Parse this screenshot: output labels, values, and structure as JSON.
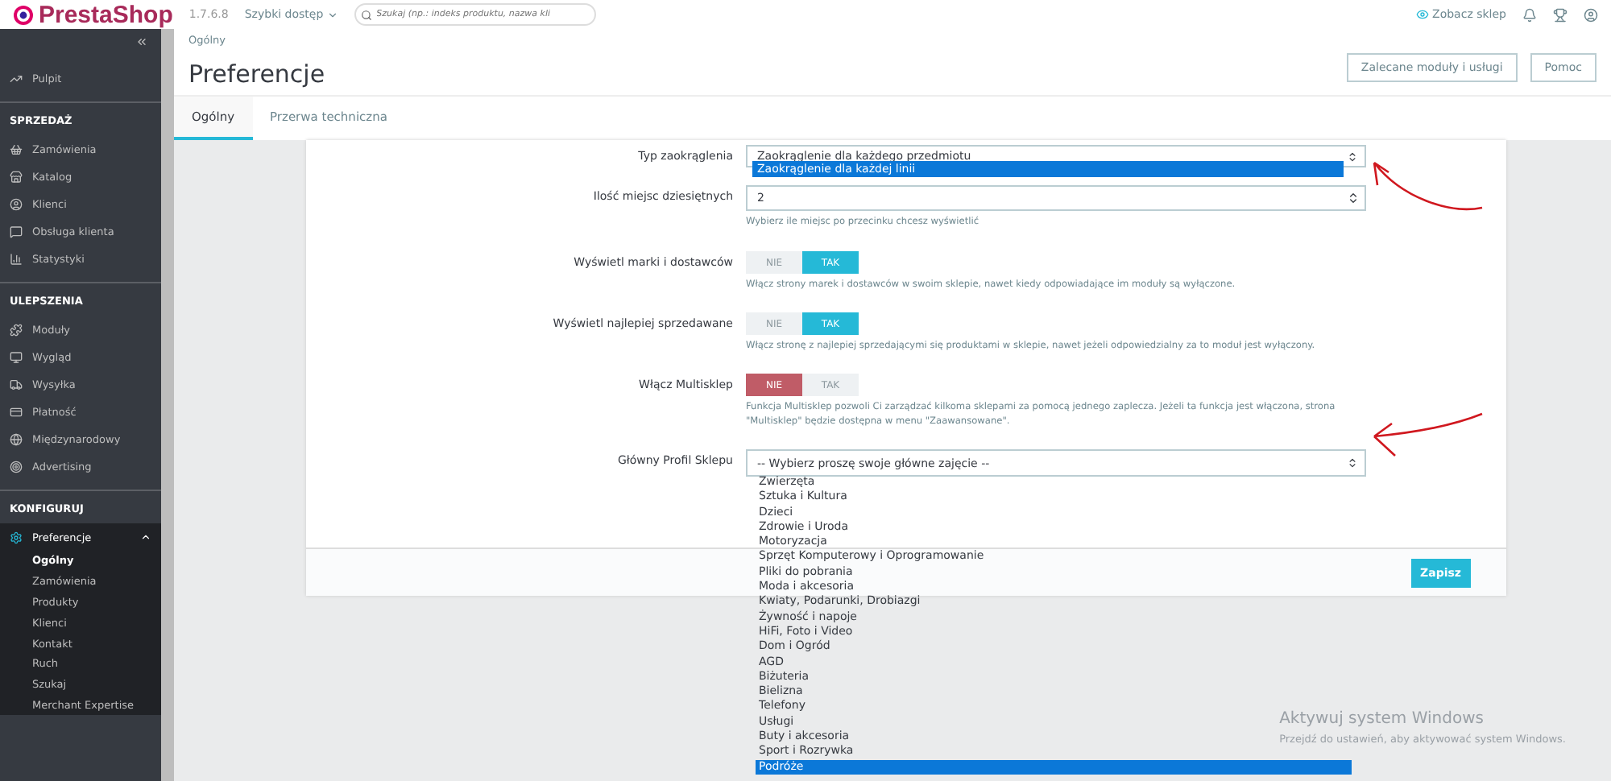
{
  "topbar": {
    "logo": "PrestaShop",
    "version": "1.7.6.8",
    "quick_access": "Szybki dostęp",
    "search": {
      "placeholder": "Szukaj (np.: indeks produktu, nazwa kli"
    },
    "view_shop": "Zobacz sklep"
  },
  "sidebar": {
    "dashboard": {
      "label": "Pulpit",
      "selected": false
    },
    "sections": [
      {
        "title": "SPRZEDAŻ",
        "items": [
          {
            "label": "Zamówienia",
            "selected": false
          },
          {
            "label": "Katalog",
            "selected": false
          },
          {
            "label": "Klienci",
            "selected": false
          },
          {
            "label": "Obsługa klienta",
            "selected": false
          },
          {
            "label": "Statystyki",
            "selected": false
          }
        ]
      },
      {
        "title": "ULEPSZENIA",
        "items": [
          {
            "label": "Moduły",
            "selected": false
          },
          {
            "label": "Wygląd",
            "selected": false
          },
          {
            "label": "Wysyłka",
            "selected": false
          },
          {
            "label": "Płatność",
            "selected": false
          },
          {
            "label": "Międzynarodowy",
            "selected": false
          },
          {
            "label": "Advertising",
            "selected": false
          }
        ]
      },
      {
        "title": "KONFIGURUJ",
        "items": [
          {
            "label": "Preferencje",
            "selected": true,
            "expanded": true,
            "children": [
              {
                "label": "Ogólny",
                "selected": true
              },
              {
                "label": "Zamówienia",
                "selected": false
              },
              {
                "label": "Produkty",
                "selected": false
              },
              {
                "label": "Klienci",
                "selected": false
              },
              {
                "label": "Kontakt",
                "selected": false
              },
              {
                "label": "Ruch",
                "selected": false
              },
              {
                "label": "Szukaj",
                "selected": false
              },
              {
                "label": "Merchant Expertise",
                "selected": false
              }
            ]
          }
        ]
      }
    ]
  },
  "header": {
    "breadcrumb": "Ogólny",
    "title": "Preferencje",
    "buttons": [
      "Zalecane moduły i usługi",
      "Pomoc"
    ],
    "tabs": [
      {
        "label": "Ogólny",
        "selected": true
      },
      {
        "label": "Przerwa techniczna",
        "selected": false
      }
    ]
  },
  "form": {
    "fields": [
      {
        "kind": "select",
        "label": "Typ zaokrąglenia",
        "value": "Zaokrąglenie dla każdego przedmiotu",
        "open_option": {
          "label": "Zaokrąglenie dla każdej linii",
          "selected": true
        }
      },
      {
        "kind": "number",
        "label": "Ilość miejsc dziesiętnych",
        "value": "2",
        "help": "Wybierz ile miejsc po przecinku chcesz wyświetlić"
      },
      {
        "kind": "toggle",
        "label": "Wyświetl marki i dostawców",
        "options": [
          "NIE",
          "TAK"
        ],
        "on": true,
        "help": "Włącz strony marek i dostawców w swoim sklepie, nawet kiedy odpowiadające im moduły są wyłączone."
      },
      {
        "kind": "toggle",
        "label": "Wyświetl najlepiej sprzedawane",
        "options": [
          "NIE",
          "TAK"
        ],
        "on": true,
        "help": "Włącz stronę z najlepiej sprzedającymi się produktami w sklepie, nawet jeżeli odpowiedzialny za to moduł jest wyłączony."
      },
      {
        "kind": "toggle",
        "label": "Włącz Multisklep",
        "options": [
          "NIE",
          "TAK"
        ],
        "on": false,
        "help": "Funkcja Multisklep pozwoli Ci zarządzać kilkoma sklepami za pomocą jednego zaplecza. Jeżeli ta funkcja jest włączona, strona \"Multisklep\" będzie dostępna w menu \"Zaawansowane\"."
      },
      {
        "kind": "select-list",
        "label": "Główny Profil Sklepu",
        "value": "-- Wybierz proszę swoje główne zajęcie --",
        "options": [
          {
            "label": "Zwierzęta",
            "selected": false
          },
          {
            "label": "Sztuka i Kultura",
            "selected": false
          },
          {
            "label": "Dzieci",
            "selected": false
          },
          {
            "label": "Zdrowie i Uroda",
            "selected": false
          },
          {
            "label": "Motoryzacja",
            "selected": false
          },
          {
            "label": "Sprzęt Komputerowy i Oprogramowanie",
            "selected": false
          },
          {
            "label": "Pliki do pobrania",
            "selected": false
          },
          {
            "label": "Moda i akcesoria",
            "selected": false
          },
          {
            "label": "Kwiaty, Podarunki, Drobiazgi",
            "selected": false
          },
          {
            "label": "Żywność i napoje",
            "selected": false
          },
          {
            "label": "HiFi, Foto i Video",
            "selected": false
          },
          {
            "label": "Dom i Ogród",
            "selected": false
          },
          {
            "label": "AGD",
            "selected": false
          },
          {
            "label": "Biżuteria",
            "selected": false
          },
          {
            "label": "Bielizna",
            "selected": false
          },
          {
            "label": "Telefony",
            "selected": false
          },
          {
            "label": "Usługi",
            "selected": false
          },
          {
            "label": "Buty i akcesoria",
            "selected": false
          },
          {
            "label": "Sport i Rozrywka",
            "selected": false
          },
          {
            "label": "Podróże",
            "selected": true
          }
        ]
      }
    ],
    "save": "Zapisz"
  },
  "os_notice": {
    "title": "Aktywuj system Windows",
    "text": "Przejdź do ustawień, aby aktywować system Windows."
  }
}
